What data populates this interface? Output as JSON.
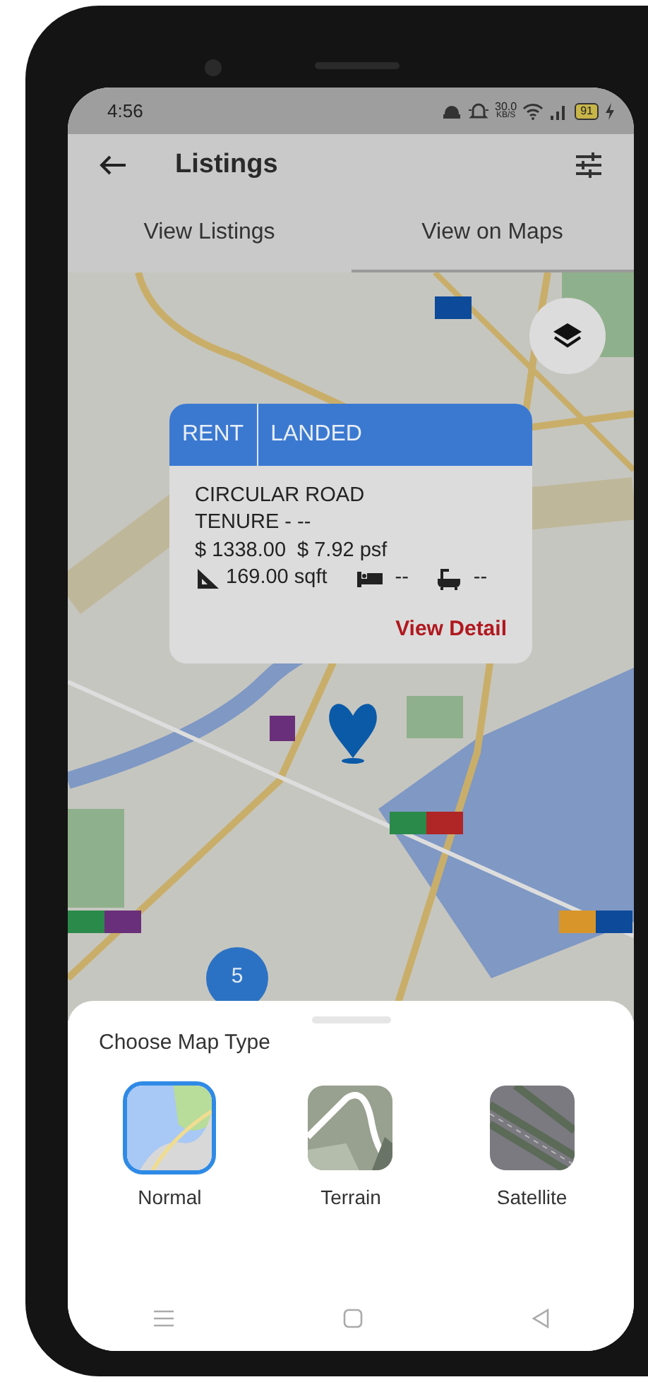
{
  "status_bar": {
    "time": "4:56",
    "speed": "30.0",
    "speed_unit": "KB/S",
    "battery": "91"
  },
  "app_bar": {
    "title": "Listings"
  },
  "tabs": [
    {
      "label": "View Listings",
      "selected": false
    },
    {
      "label": "View on Maps",
      "selected": true
    }
  ],
  "map": {
    "markers": [
      {
        "segments": [
          {
            "color": "#0d4a9a"
          }
        ]
      },
      {
        "segments": [
          {
            "color": "#6a2f7a"
          }
        ]
      },
      {
        "segments": [
          {
            "color": "#2a8a4a"
          },
          {
            "color": "#b02525"
          }
        ]
      },
      {
        "segments": [
          {
            "color": "#2a8a4a"
          },
          {
            "color": "#6a2f7a"
          }
        ]
      },
      {
        "segments": [
          {
            "color": "#d8962a"
          },
          {
            "color": "#0d4a9a"
          }
        ]
      }
    ],
    "cluster": {
      "count": "5"
    },
    "popup": {
      "tags": [
        "RENT",
        "LANDED"
      ],
      "address": "CIRCULAR ROAD",
      "tenure": "TENURE - --",
      "price": "$ 1338.00",
      "psf": "$ 7.92 psf",
      "area": "169.00 sqft",
      "bedrooms": "--",
      "bathrooms": "--",
      "action": "View Detail"
    }
  },
  "sheet": {
    "title": "Choose Map Type",
    "options": [
      {
        "label": "Normal",
        "kind": "normal",
        "selected": true
      },
      {
        "label": "Terrain",
        "kind": "terrain",
        "selected": false
      },
      {
        "label": "Satellite",
        "kind": "satellite",
        "selected": false
      }
    ]
  }
}
